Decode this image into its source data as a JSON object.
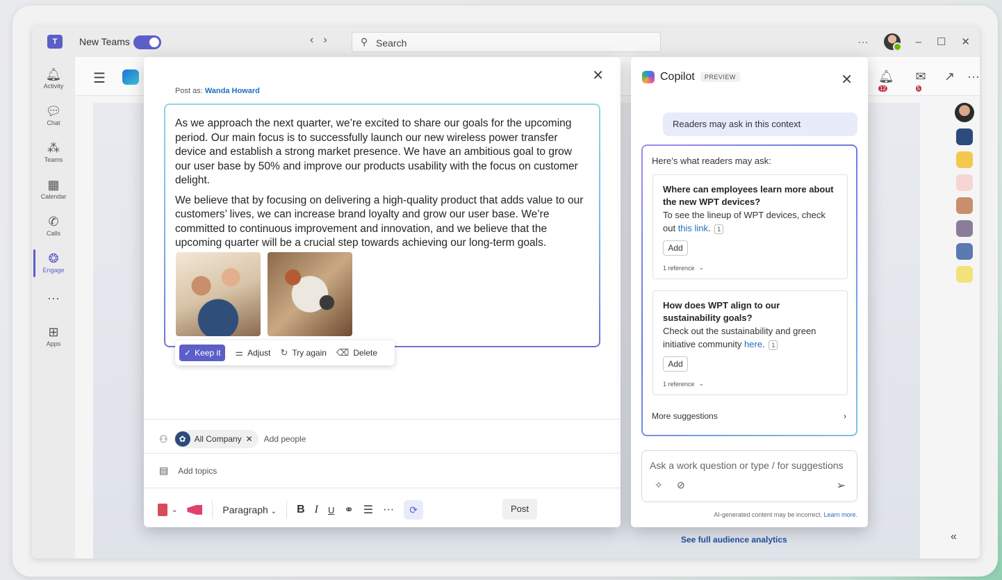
{
  "titlebar": {
    "app_label": "New Teams",
    "search_placeholder": "Search",
    "back_arrow": "‹",
    "forward_arrow": "›",
    "more": "···",
    "minimize": "–",
    "maximize": "☐",
    "close": "✕"
  },
  "rail": {
    "items": [
      {
        "label": "Activity",
        "icon": "bell-icon"
      },
      {
        "label": "Chat",
        "icon": "chat-icon"
      },
      {
        "label": "Teams",
        "icon": "teams-icon"
      },
      {
        "label": "Calendar",
        "icon": "calendar-icon"
      },
      {
        "label": "Calls",
        "icon": "phone-icon"
      },
      {
        "label": "Engage",
        "icon": "engage-icon"
      },
      {
        "label": "",
        "icon": "more-icon"
      },
      {
        "label": "Apps",
        "icon": "apps-icon"
      }
    ]
  },
  "app": {
    "notif_badge_1": "12",
    "notif_badge_2": "5",
    "see_analytics": "See full audience analytics"
  },
  "composer": {
    "post_as_label": "Post as:",
    "post_as_name": "Wanda Howard",
    "paragraph_1": "As we approach the next quarter, we’re excited to share our goals for the upcoming period. Our main focus is to successfully launch our new wireless power transfer device and establish a strong market presence. We have an ambitious goal to grow our user base by 50% and improve our products usability with the focus on customer delight.",
    "paragraph_2": "We believe that by focusing on delivering a high-quality product that adds value to our customers’ lives, we can increase brand loyalty and grow our user base. We’re committed to continuous improvement and innovation, and we believe that the upcoming quarter will be a crucial step towards achieving our long-term goals.",
    "ai_actions": {
      "keep": "Keep it",
      "adjust": "Adjust",
      "try_again": "Try again",
      "delete": "Delete"
    },
    "audience_chip": "All Company",
    "add_people": "Add people",
    "add_topics": "Add topics",
    "format": "Paragraph",
    "post_button": "Post"
  },
  "copilot": {
    "title": "Copilot",
    "badge": "PREVIEW",
    "user_message": "Readers may ask in this context",
    "intro": "Here’s what readers may ask:",
    "suggestions": [
      {
        "question": "Where can employees learn more about the new WPT devices?",
        "answer_pre": "To see the lineup of WPT devices, check out ",
        "answer_link": "this link",
        "answer_post": ".",
        "citation": "1",
        "add_label": "Add",
        "reference_label": "1 reference"
      },
      {
        "question": "How does WPT align to our sustainability goals?",
        "answer_pre": "Check out the sustainability and green initiative community ",
        "answer_link": "here",
        "answer_post": ".",
        "citation": "1",
        "add_label": "Add",
        "reference_label": "1 reference"
      }
    ],
    "more_suggestions": "More suggestions",
    "input_placeholder": "Ask a work question or type / for suggestions",
    "disclaimer": "AI-generated content may be incorrect.",
    "learn_more": "Learn more."
  }
}
